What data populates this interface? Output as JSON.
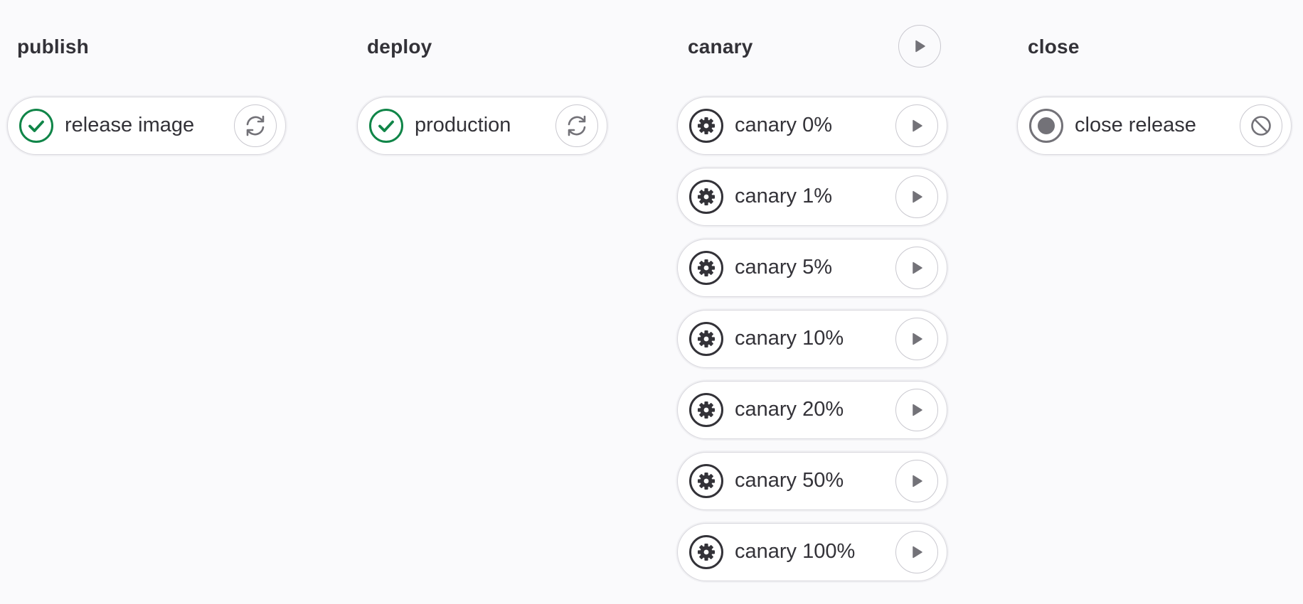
{
  "stages": [
    {
      "title": "publish",
      "jobs": [
        {
          "name": "release image",
          "status_icon": "success-check-icon",
          "action_icon": "retry-icon"
        }
      ]
    },
    {
      "title": "deploy",
      "jobs": [
        {
          "name": "production",
          "status_icon": "success-check-icon",
          "action_icon": "retry-icon"
        }
      ]
    },
    {
      "title": "canary",
      "stage_action_icon": "play-icon",
      "jobs": [
        {
          "name": "canary 0%",
          "status_icon": "manual-gear-icon",
          "action_icon": "play-icon"
        },
        {
          "name": "canary 1%",
          "status_icon": "manual-gear-icon",
          "action_icon": "play-icon"
        },
        {
          "name": "canary 5%",
          "status_icon": "manual-gear-icon",
          "action_icon": "play-icon"
        },
        {
          "name": "canary 10%",
          "status_icon": "manual-gear-icon",
          "action_icon": "play-icon"
        },
        {
          "name": "canary 20%",
          "status_icon": "manual-gear-icon",
          "action_icon": "play-icon"
        },
        {
          "name": "canary 50%",
          "status_icon": "manual-gear-icon",
          "action_icon": "play-icon"
        },
        {
          "name": "canary 100%",
          "status_icon": "manual-gear-icon",
          "action_icon": "play-icon"
        }
      ]
    },
    {
      "title": "close",
      "jobs": [
        {
          "name": "close release",
          "status_icon": "created-dot-icon",
          "action_icon": "cancel-icon"
        }
      ]
    }
  ],
  "colors": {
    "success": "#108548",
    "manual": "#333238",
    "created": "#737278",
    "action_icon": "#737278"
  }
}
